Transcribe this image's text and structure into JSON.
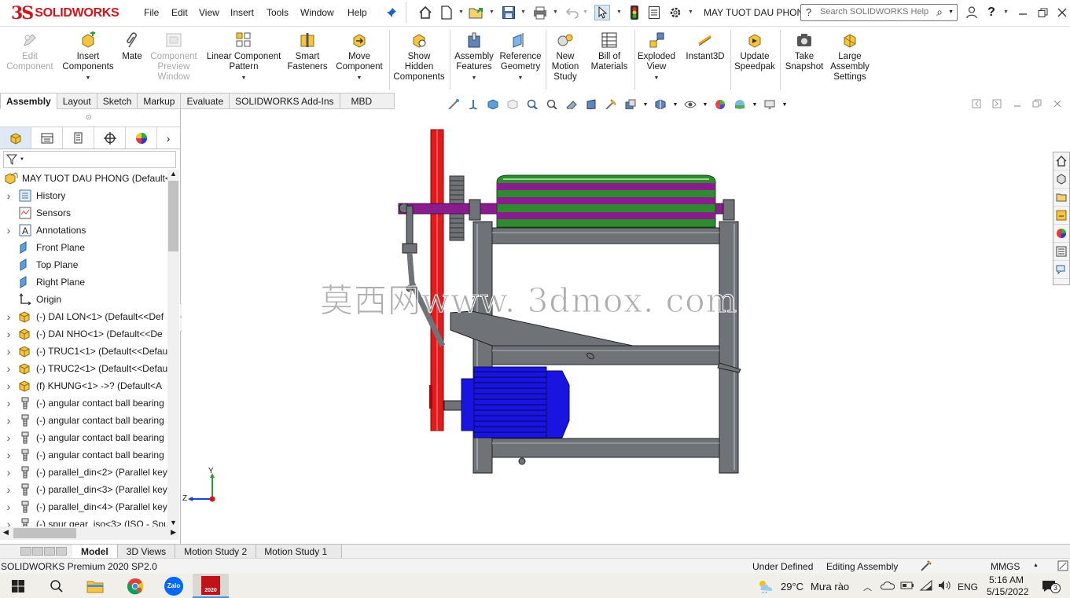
{
  "brand": {
    "logo_ds": "3S",
    "logo_text": "SOLIDWORKS"
  },
  "menu": [
    "File",
    "Edit",
    "View",
    "Insert",
    "Tools",
    "Window",
    "Help"
  ],
  "document_title": "MAY TUOT DAU PHONG...",
  "search": {
    "placeholder": "Search SOLIDWORKS Help"
  },
  "commands": [
    {
      "label": "Edit\nComponent",
      "enabled": false
    },
    {
      "label": "Insert\nComponents",
      "enabled": true
    },
    {
      "label": "Mate",
      "enabled": true
    },
    {
      "label": "Component\nPreview\nWindow",
      "enabled": false
    },
    {
      "label": "Linear Component\nPattern",
      "enabled": true
    },
    {
      "label": "Smart\nFasteners",
      "enabled": true
    },
    {
      "label": "Move\nComponent",
      "enabled": true
    },
    {
      "label": "Show\nHidden\nComponents",
      "enabled": true
    },
    {
      "label": "Assembly\nFeatures",
      "enabled": true
    },
    {
      "label": "Reference\nGeometry",
      "enabled": true
    },
    {
      "label": "New\nMotion\nStudy",
      "enabled": true
    },
    {
      "label": "Bill of\nMaterials",
      "enabled": true
    },
    {
      "label": "Exploded\nView",
      "enabled": true
    },
    {
      "label": "Instant3D",
      "enabled": true
    },
    {
      "label": "Update\nSpeedpak",
      "enabled": true
    },
    {
      "label": "Take\nSnapshot",
      "enabled": true
    },
    {
      "label": "Large\nAssembly\nSettings",
      "enabled": true
    }
  ],
  "command_tabs": [
    "Assembly",
    "Layout",
    "Sketch",
    "Markup",
    "Evaluate",
    "SOLIDWORKS Add-Ins",
    "MBD"
  ],
  "active_command_tab": "Assembly",
  "feature_tree": {
    "root": "MAY TUOT DAU PHONG  (Default<",
    "items": [
      {
        "label": "History",
        "icon": "history-icon"
      },
      {
        "label": "Sensors",
        "icon": "sensors-icon"
      },
      {
        "label": "Annotations",
        "icon": "annotations-icon"
      },
      {
        "label": "Front Plane",
        "icon": "plane-icon"
      },
      {
        "label": "Top Plane",
        "icon": "plane-icon"
      },
      {
        "label": "Right Plane",
        "icon": "plane-icon"
      },
      {
        "label": "Origin",
        "icon": "origin-icon"
      },
      {
        "label": "(-) DAI LON<1> (Default<<Def",
        "icon": "part-icon"
      },
      {
        "label": "(-) DAI NHO<1> (Default<<De",
        "icon": "part-icon"
      },
      {
        "label": "(-) TRUC1<1> (Default<<Defau",
        "icon": "part-icon"
      },
      {
        "label": "(-) TRUC2<1> (Default<<Defau",
        "icon": "part-icon"
      },
      {
        "label": "(f) KHUNG<1> ->? (Default<A",
        "icon": "part-icon"
      },
      {
        "label": "(-) angular contact ball bearing",
        "icon": "toolbox-part-icon"
      },
      {
        "label": "(-) angular contact ball bearing",
        "icon": "toolbox-part-icon"
      },
      {
        "label": "(-) angular contact ball bearing",
        "icon": "toolbox-part-icon"
      },
      {
        "label": "(-) angular contact ball bearing",
        "icon": "toolbox-part-icon"
      },
      {
        "label": "(-) parallel_din<2> (Parallel key",
        "icon": "toolbox-part-icon"
      },
      {
        "label": "(-) parallel_din<3> (Parallel key",
        "icon": "toolbox-part-icon"
      },
      {
        "label": "(-) parallel_din<4> (Parallel key",
        "icon": "toolbox-part-icon"
      },
      {
        "label": "(-) spur gear_iso<3> (ISO - Spu",
        "icon": "toolbox-part-icon"
      }
    ]
  },
  "viewport": {
    "watermark": "莫西网www. 3dmox. com",
    "triad": {
      "x": "",
      "y": "Y",
      "z": "Z"
    }
  },
  "bottom_tabs": [
    "Model",
    "3D Views",
    "Motion Study 2",
    "Motion Study 1"
  ],
  "active_bottom_tab": "Model",
  "status": {
    "product": "SOLIDWORKS Premium 2020 SP2.0",
    "definition": "Under Defined",
    "mode": "Editing Assembly",
    "units": "MMGS"
  },
  "taskbar": {
    "weather_temp": "29°C",
    "weather_text": "Mưa rào",
    "language": "ENG",
    "time": "5:16 AM",
    "date": "5/15/2022",
    "notification_count": "3",
    "apps": [
      "start-icon",
      "search-icon",
      "file-explorer-icon",
      "chrome-icon",
      "zalo-icon",
      "solidworks-icon"
    ],
    "zalo_label": "Zalo",
    "sw_label": "2020"
  },
  "colors": {
    "brand_red": "#d8121a",
    "frame_gray": "#6f7277",
    "roller_purple": "#8a1c8e",
    "roller_green": "#2e8b2e",
    "belt_red": "#e11b1b",
    "motor_blue": "#1a14e0"
  }
}
